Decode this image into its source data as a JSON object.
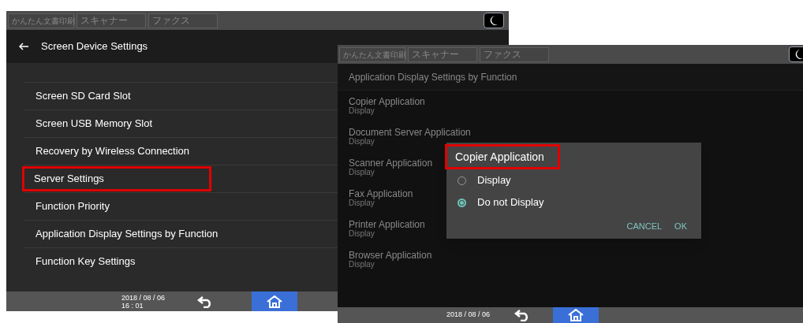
{
  "settings_screen": {
    "tabs": [
      "かんたん文書印刷",
      "スキャナー",
      "ファクス"
    ],
    "header": {
      "title": "Screen Device Settings"
    },
    "items": [
      {
        "label": "Screen SD Card Slot",
        "highlighted": false
      },
      {
        "label": "Screen USB Memory Slot",
        "highlighted": false
      },
      {
        "label": "Recovery by Wireless Connection",
        "highlighted": false
      },
      {
        "label": "Server Settings",
        "highlighted": true
      },
      {
        "label": "Function Priority",
        "highlighted": false
      },
      {
        "label": "Application Display Settings by Function",
        "highlighted": false
      },
      {
        "label": "Function Key Settings",
        "highlighted": false
      }
    ],
    "footer": {
      "date": "2018 / 08 / 06",
      "time": "16 : 01"
    }
  },
  "application_screen": {
    "tabs": [
      "かんたん文書印刷",
      "スキャナー",
      "ファクス"
    ],
    "heading": "Application Display Settings by Function",
    "items": [
      {
        "title": "Copier Application",
        "value": "Display"
      },
      {
        "title": "Document Server Application",
        "value": "Display"
      },
      {
        "title": "Scanner Application",
        "value": "Display"
      },
      {
        "title": "Fax Application",
        "value": "Display"
      },
      {
        "title": "Printer Application",
        "value": "Display"
      },
      {
        "title": "Browser Application",
        "value": "Display"
      }
    ],
    "dialog": {
      "title": "Copier Application",
      "title_highlighted": true,
      "options": [
        {
          "label": "Display",
          "selected": false
        },
        {
          "label": "Do not Display",
          "selected": true
        }
      ],
      "buttons": [
        "CANCEL",
        "OK"
      ]
    },
    "footer": {
      "date": "2018 / 08 / 06"
    }
  }
}
